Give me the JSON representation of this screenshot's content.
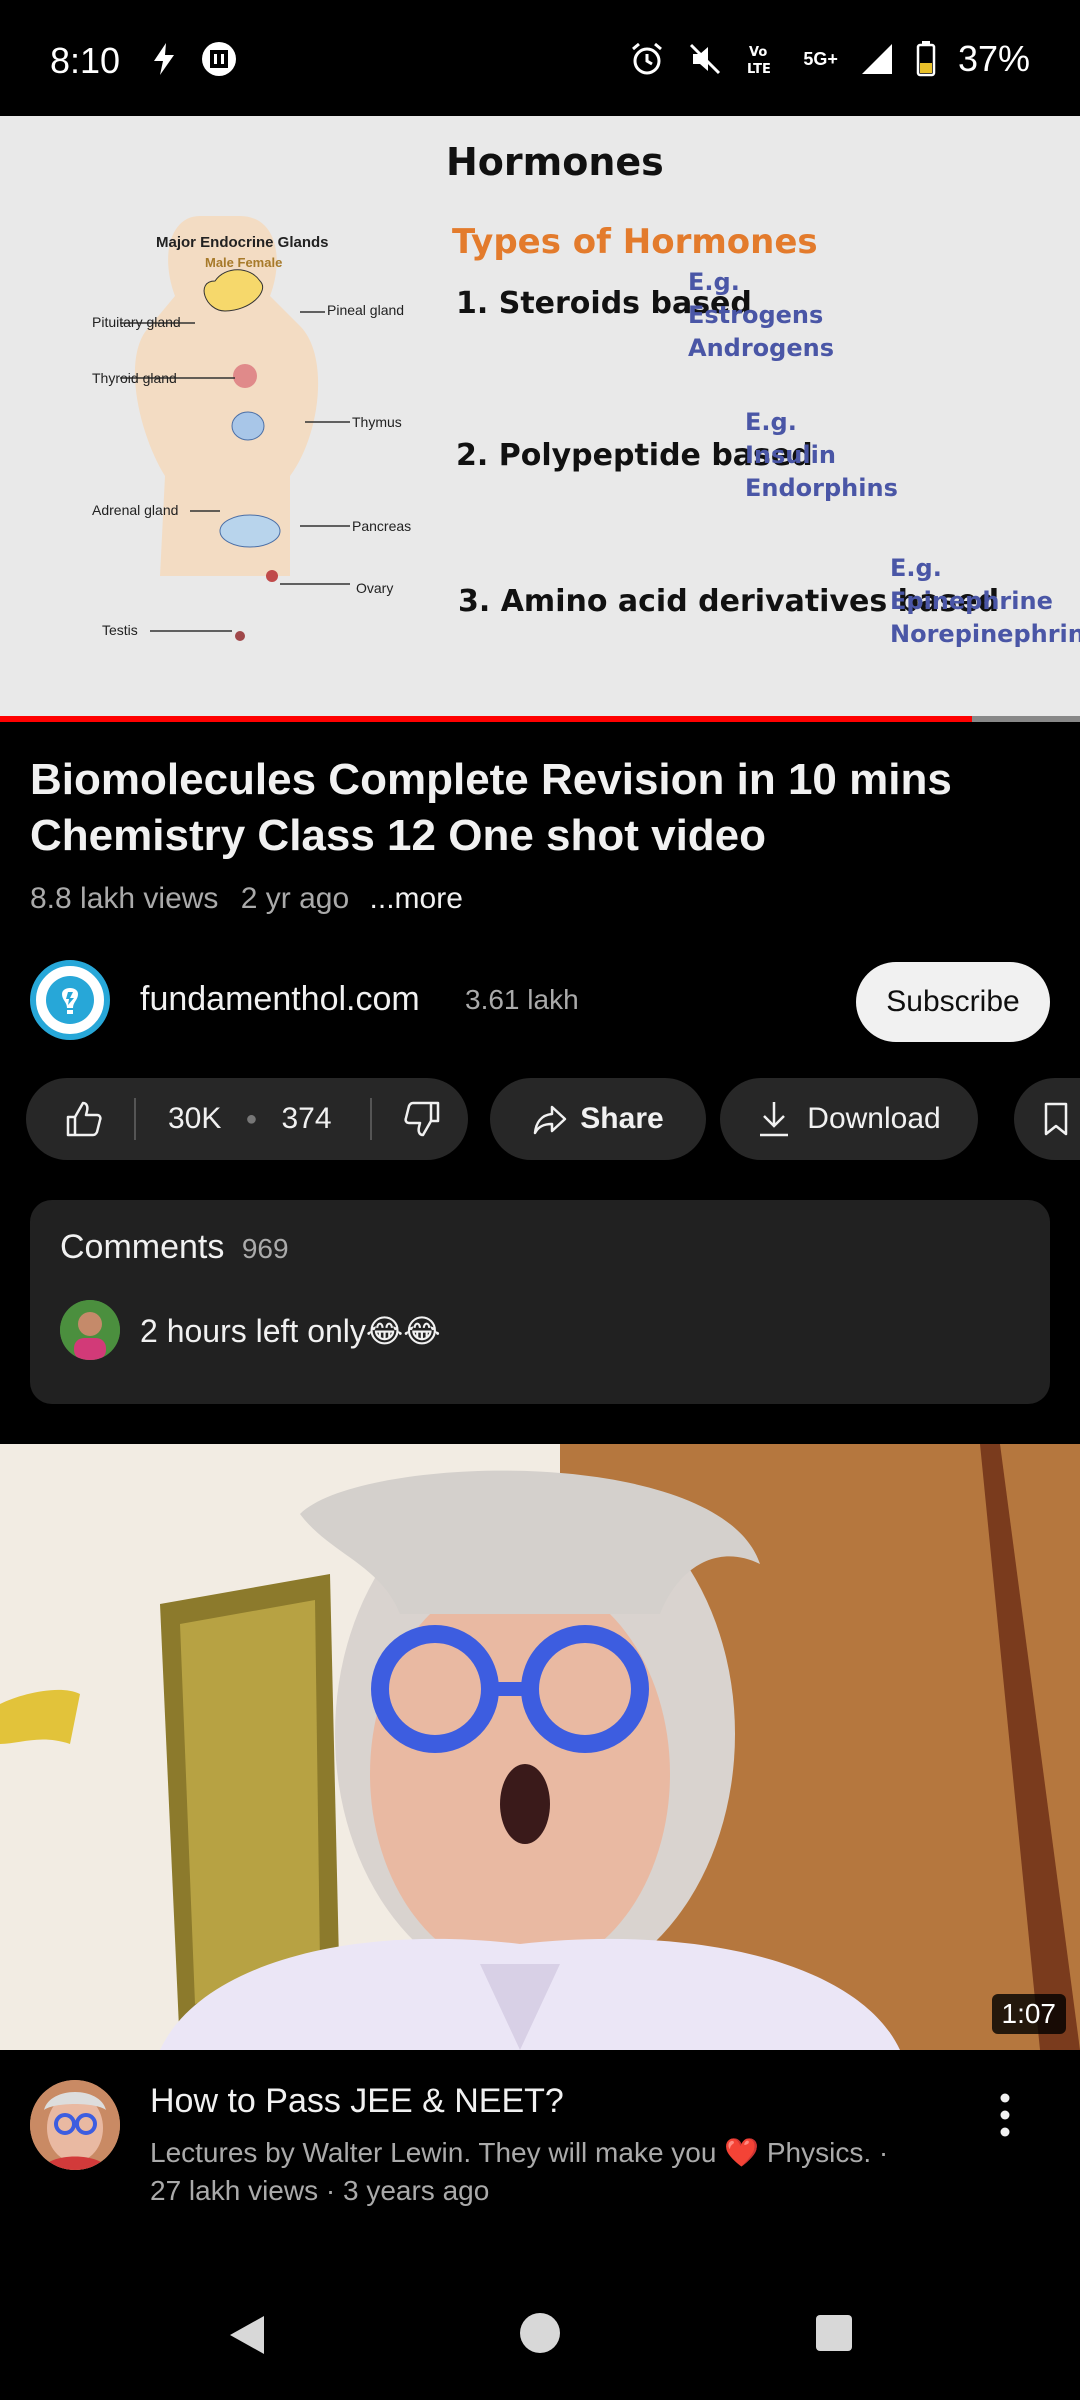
{
  "status_bar": {
    "time": "8:10",
    "battery": "37%",
    "network": "5G+",
    "icons": [
      "flash-icon",
      "vpn-icon",
      "alarm-icon",
      "mute-icon",
      "volte-icon",
      "signal-icon",
      "battery-icon"
    ]
  },
  "player": {
    "slide": {
      "title": "Hormones",
      "subtitle": "Types of Hormones",
      "items": [
        {
          "label": "1. Steroids based",
          "eg": [
            "E.g.",
            "Estrogens",
            "Androgens"
          ]
        },
        {
          "label": "2. Polypeptide based",
          "eg": [
            "E.g.",
            "Insulin",
            "Endorphins"
          ]
        },
        {
          "label": "3. Amino acid derivatives based",
          "eg": [
            "E.g.",
            "Epinephrine",
            "Norepinephrine"
          ]
        }
      ],
      "diagram": {
        "title": "Major Endocrine Glands",
        "male_female": "Male    Female",
        "labels": {
          "pituitary": "Pituitary gland",
          "thyroid": "Thyroid gland",
          "adrenal": "Adrenal gland",
          "testis": "Testis",
          "pineal": "Pineal gland",
          "thymus": "Thymus",
          "pancreas": "Pancreas",
          "ovary": "Ovary"
        }
      }
    },
    "progress": 0.9
  },
  "video": {
    "title": "Biomolecules Complete Revision in 10 mins Chemistry Class 12 One shot video",
    "views": "8.8 lakh views",
    "age": "2 yr ago",
    "more": "...more"
  },
  "channel": {
    "name": "fundamenthol.com",
    "subscribers": "3.61 lakh",
    "subscribe_label": "Subscribe"
  },
  "actions": {
    "likes": "30K",
    "dislikes": "374",
    "share_label": "Share",
    "download_label": "Download"
  },
  "comments": {
    "label": "Comments",
    "count": "969",
    "top_comment": "2 hours left only😂😂"
  },
  "next_video": {
    "duration": "1:07",
    "title": "How to Pass JEE & NEET?",
    "channel_line": "Lectures by Walter Lewin. They will make you ❤️ Physics. ·",
    "stats": "27 lakh views · 3 years ago"
  },
  "colors": {
    "accent_red": "#ff0000",
    "pill_bg": "#272727",
    "slide_orange": "#e37b2c",
    "slide_blue": "#4a56a6"
  }
}
